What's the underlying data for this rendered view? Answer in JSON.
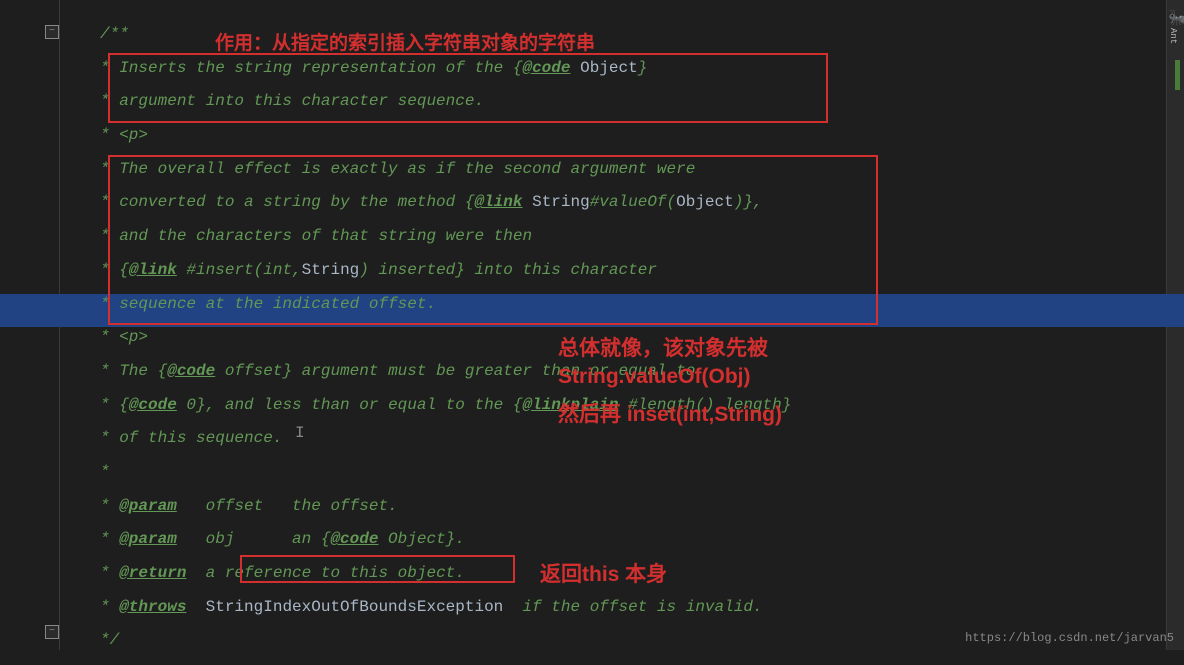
{
  "gutter": {
    "collapse_icon": "−"
  },
  "lines": {
    "l0": "/**",
    "l1_pre": "* ",
    "l1_txt": "Inserts the string representation of the {",
    "l1_tag": "@code",
    "l1_code": " Object",
    "l1_suf": "}",
    "l2_pre": "* ",
    "l2_txt": "argument into this character sequence.",
    "l3_pre": "* ",
    "l3_txt": "<p>",
    "l4_pre": "* ",
    "l4_txt": "The overall effect is exactly as if the second argument were",
    "l5_pre": "* ",
    "l5_txt": "converted to a string by the method {",
    "l5_tag": "@link",
    "l5_code": " String",
    "l5_mid": "#valueOf(",
    "l5_code2": "Object",
    "l5_suf": ")},",
    "l6_pre": "* ",
    "l6_txt": "and the characters of that string were then",
    "l7_pre": "* ",
    "l7_a": "{",
    "l7_tag": "@link",
    "l7_mid": " #insert(int,",
    "l7_code": "String",
    "l7_b": ") inserted} into this character",
    "l8_pre": "* ",
    "l8_txt": "sequence at the indicated offset.",
    "l9_pre": "* ",
    "l9_txt": "<p>",
    "l10_pre": "* ",
    "l10_a": "The {",
    "l10_tag": "@code",
    "l10_b": " offset} argument must be greater than or equal to",
    "l11_pre": "* ",
    "l11_a": "{",
    "l11_tag": "@code",
    "l11_b": " 0}, and less than or equal to the {",
    "l11_tag2": "@linkplain",
    "l11_c": " #length() length}",
    "l12_pre": "* ",
    "l12_txt": "of this sequence.",
    "l13_pre": "*",
    "l14_pre": "* ",
    "l14_tag": "@param",
    "l14_txt": "   offset   the offset.",
    "l15_pre": "* ",
    "l15_tag": "@param",
    "l15_txt": "   obj      an {",
    "l15_tag2": "@code",
    "l15_b": " Object}.",
    "l16_pre": "* ",
    "l16_tag": "@return",
    "l16_txt": "  a reference to this object.",
    "l17_pre": "* ",
    "l17_tag": "@throws",
    "l17_code": "  StringIndexOutOfBoundsException",
    "l17_txt": "  if the offset is invalid.",
    "l18_pre": "*/"
  },
  "annotations": {
    "title": "作用：从指定的索引插入字符串对象的字符串",
    "note1": "总体就像，该对象先被",
    "note2": "String.valueOf(Obj)",
    "note3": "然后再 inset(int,String)",
    "note4": "返回this 本身"
  },
  "watermark": "https://blog.csdn.net/jarvan5",
  "sidebar": {
    "ant": "Ant"
  }
}
